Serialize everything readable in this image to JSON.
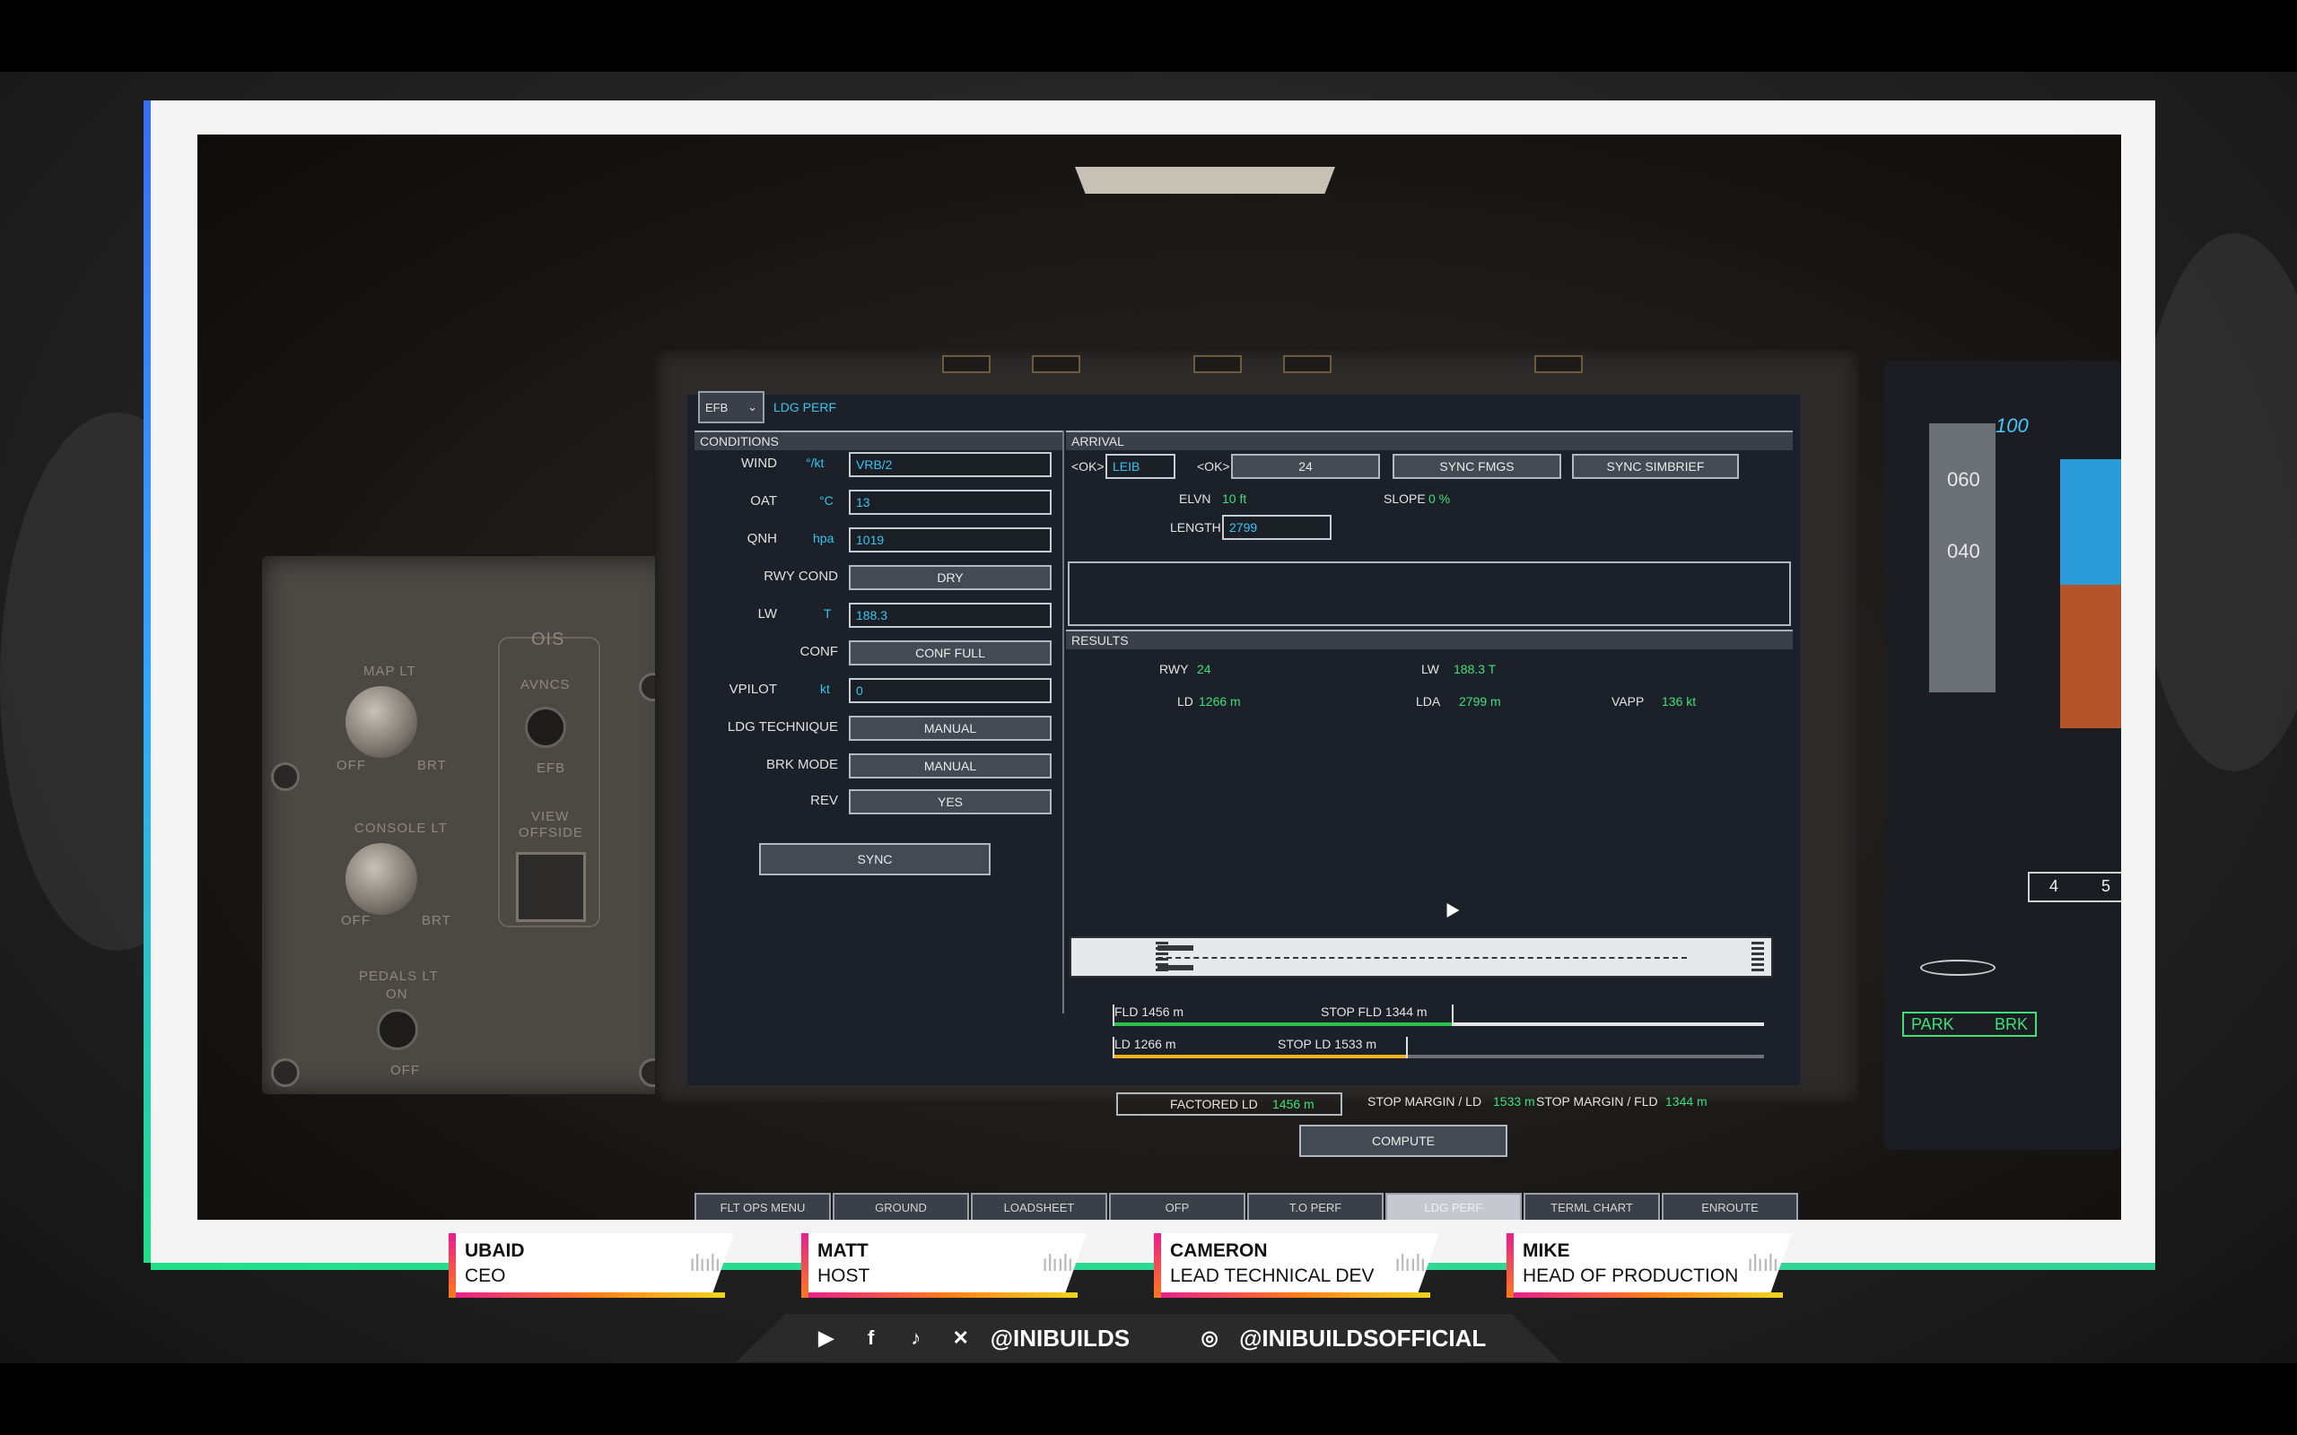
{
  "efb": {
    "selector": "EFB",
    "page": "LDG PERF",
    "conditions": {
      "title": "CONDITIONS",
      "wind": {
        "label": "WIND",
        "unit": "°/kt",
        "value": "VRB/2"
      },
      "oat": {
        "label": "OAT",
        "unit": "°C",
        "value": "13"
      },
      "qnh": {
        "label": "QNH",
        "unit": "hpa",
        "value": "1019"
      },
      "rwy_cond": {
        "label": "RWY COND",
        "value": "DRY"
      },
      "lw": {
        "label": "LW",
        "unit": "T",
        "value": "188.3"
      },
      "conf": {
        "label": "CONF",
        "value": "CONF FULL"
      },
      "vpilot": {
        "label": "VPILOT",
        "unit": "kt",
        "value": "0"
      },
      "ldg_technique": {
        "label": "LDG TECHNIQUE",
        "value": "MANUAL"
      },
      "brk_mode": {
        "label": "BRK MODE",
        "value": "MANUAL"
      },
      "rev": {
        "label": "REV",
        "value": "YES"
      },
      "sync": "SYNC"
    },
    "arrival": {
      "title": "ARRIVAL",
      "ok1": "<OK>",
      "airport": "LEIB",
      "ok2": "<OK>",
      "runway": "24",
      "sync_fmgs": "SYNC FMGS",
      "sync_simbrief": "SYNC SIMBRIEF",
      "elvn_label": "ELVN",
      "elvn_value": "10 ft",
      "slope_label": "SLOPE",
      "slope_value": "0 %",
      "length_label": "LENGTH",
      "length_value": "2799"
    },
    "results": {
      "title": "RESULTS",
      "rwy_label": "RWY",
      "rwy_value": "24",
      "lw_label": "LW",
      "lw_value": "188.3 T",
      "ld_label": "LD",
      "ld_value": "1266 m",
      "lda_label": "LDA",
      "lda_value": "2799 m",
      "vapp_label": "VAPP",
      "vapp_value": "136 kt",
      "fld_label": "FLD 1456 m",
      "stop_fld_label": "STOP FLD 1344 m",
      "fld_fraction": 0.52,
      "ld_bar_label": "LD 1266 m",
      "stop_ld_label": "STOP LD 1533 m",
      "ld_fraction": 0.45,
      "factored_ld_label": "FACTORED LD",
      "factored_ld_value": "1456 m",
      "stop_margin_ld_label": "STOP MARGIN / LD",
      "stop_margin_ld_value": "1533 m",
      "stop_margin_fld_label": "STOP MARGIN / FLD",
      "stop_margin_fld_value": "1344 m",
      "compute": "COMPUTE"
    },
    "tabs": [
      "FLT OPS MENU",
      "GROUND",
      "LOADSHEET",
      "OFP",
      "T.O PERF",
      "LDG PERF",
      "TERML CHART",
      "ENROUTE"
    ],
    "active_tab": "LDG PERF"
  },
  "cockpit_panel": {
    "map_lt": "MAP LT",
    "console_lt": "CONSOLE LT",
    "pedals_lt": "PEDALS LT",
    "on": "ON",
    "off": "OFF",
    "brt": "BRT",
    "ois": "OIS",
    "avncs": "AVNCS",
    "efb": "EFB",
    "view": "VIEW",
    "offside": "OFFSIDE"
  },
  "pfd": {
    "speed_100": "100",
    "speed_060": "060",
    "speed_040": "040",
    "park_brk": "PARK",
    "brk": "BRK",
    "scale_4": "4",
    "scale_5": "5"
  },
  "hosts": [
    {
      "name": "UBAID",
      "role": "CEO"
    },
    {
      "name": "MATT",
      "role": "HOST"
    },
    {
      "name": "CAMERON",
      "role": "LEAD TECHNICAL DEV"
    },
    {
      "name": "MIKE",
      "role": "HEAD OF PRODUCTION"
    }
  ],
  "social": {
    "handle1": "@INIBUILDS",
    "handle2": "@INIBUILDSOFFICIAL"
  },
  "colors": {
    "accent_cyan": "#31c6f2",
    "value_green": "#3ee07a",
    "bar_green": "#2fbf4f",
    "bar_yellow": "#f2b21d"
  }
}
